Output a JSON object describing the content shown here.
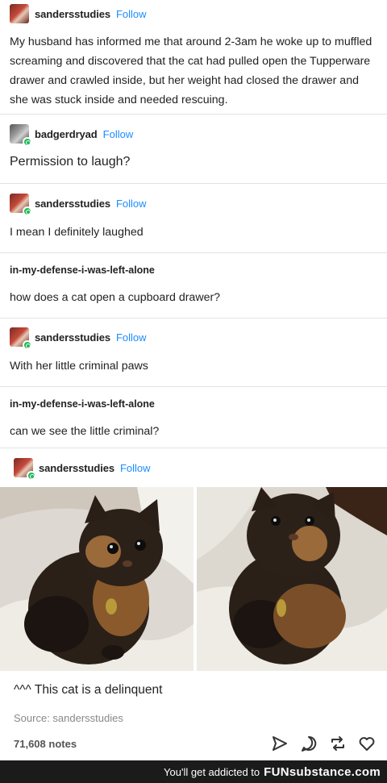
{
  "posts": [
    {
      "username": "sandersstudies",
      "follow": "Follow",
      "text": "My husband has informed me that around 2-3am he woke up to muffled screaming and discovered that the cat had pulled open the Tupperware drawer and crawled inside, but her weight had closed the drawer and she was stuck inside and needed rescuing."
    },
    {
      "username": "badgerdryad",
      "follow": "Follow",
      "text": "Permission to laugh?"
    },
    {
      "username": "sandersstudies",
      "follow": "Follow",
      "text": "I mean I definitely laughed"
    },
    {
      "username": "in-my-defense-i-was-left-alone",
      "text": "how does a cat open a cupboard drawer?"
    },
    {
      "username": "sandersstudies",
      "follow": "Follow",
      "text": "With her little criminal paws"
    },
    {
      "username": "in-my-defense-i-was-left-alone",
      "text": "can we see the little criminal?"
    },
    {
      "username": "sandersstudies",
      "follow": "Follow",
      "text": "^^^ This cat is a delinquent"
    }
  ],
  "source": "Source: sandersstudies",
  "notes": "71,608 notes",
  "actions": [
    "share-icon",
    "reply-icon",
    "reblog-icon",
    "like-icon"
  ],
  "footer": {
    "text": "You'll get addicted to",
    "brand": "FUNsubstance.com"
  },
  "colors": {
    "follow": "#1a8cff",
    "badge": "#1eb955",
    "footer_bg": "#1b1b1b"
  }
}
